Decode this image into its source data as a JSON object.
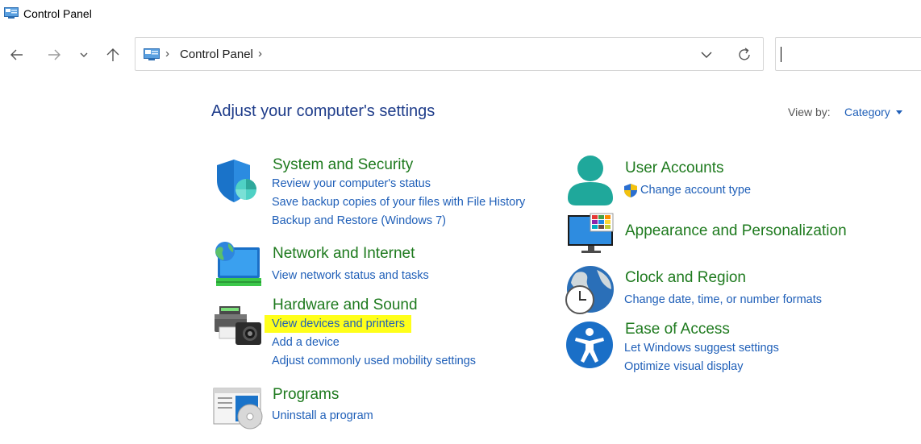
{
  "window": {
    "title": "Control Panel"
  },
  "address_bar": {
    "crumb": "Control Panel",
    "separator": "›"
  },
  "search": {
    "value": ""
  },
  "page": {
    "heading": "Adjust your computer's settings",
    "view_by_label": "View by:",
    "view_by_value": "Category"
  },
  "categories": {
    "system_security": {
      "title": "System and Security",
      "links": [
        "Review your computer's status",
        "Save backup copies of your files with File History",
        "Backup and Restore (Windows 7)"
      ]
    },
    "network": {
      "title": "Network and Internet",
      "links": [
        "View network status and tasks"
      ]
    },
    "hardware": {
      "title": "Hardware and Sound",
      "links": [
        "View devices and printers",
        "Add a device",
        "Adjust commonly used mobility settings"
      ]
    },
    "programs": {
      "title": "Programs",
      "links": [
        "Uninstall a program"
      ]
    },
    "user_accounts": {
      "title": "User Accounts",
      "links": [
        "Change account type"
      ]
    },
    "appearance": {
      "title": "Appearance and Personalization"
    },
    "clock": {
      "title": "Clock and Region",
      "links": [
        "Change date, time, or number formats"
      ]
    },
    "ease": {
      "title": "Ease of Access",
      "links": [
        "Let Windows suggest settings",
        "Optimize visual display"
      ]
    }
  },
  "colors": {
    "heading": "#1e3c8a",
    "category_title": "#1e7a1e",
    "link": "#1f5fb8",
    "highlight": "#ffff1a"
  },
  "icons": {
    "title": "control-panel-icon",
    "back": "back-arrow-icon",
    "forward": "forward-arrow-icon",
    "recent": "chevron-down-icon",
    "up": "up-arrow-icon",
    "refresh": "refresh-icon"
  }
}
